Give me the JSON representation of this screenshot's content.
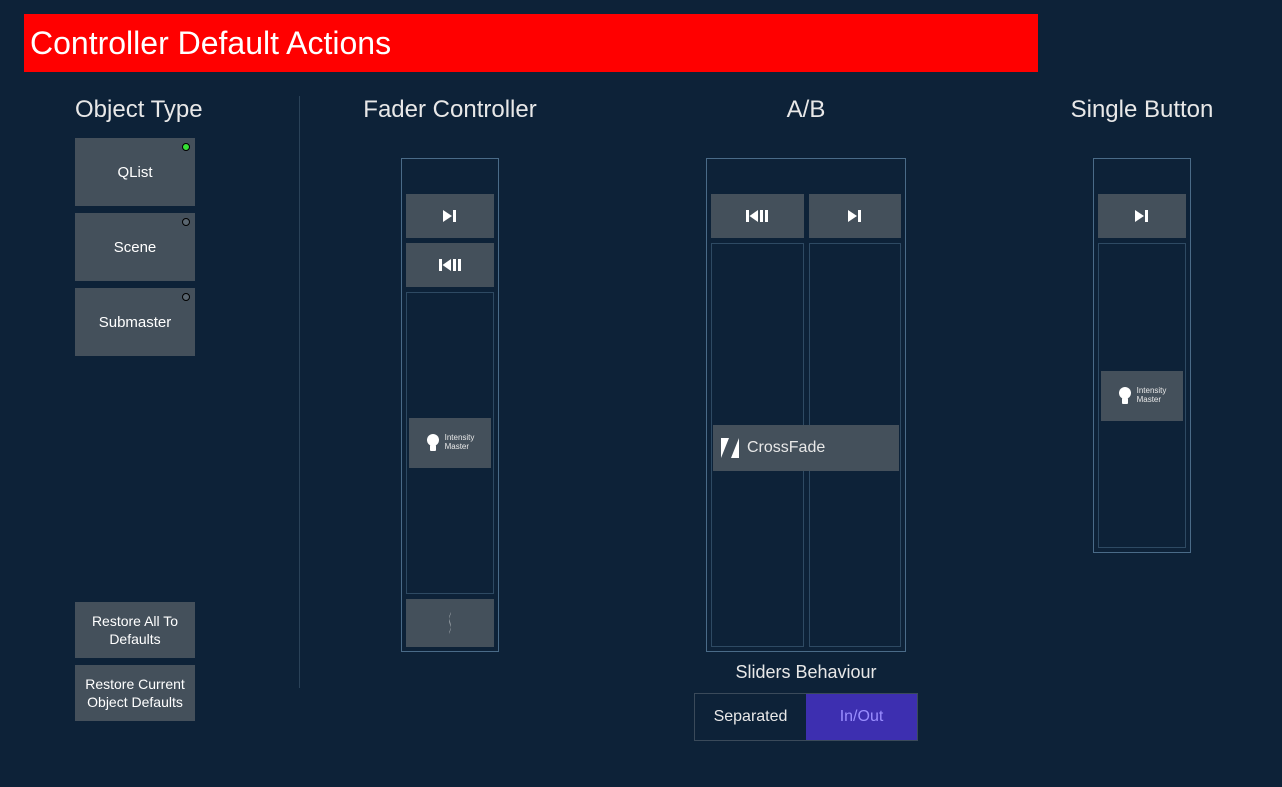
{
  "banner": {
    "title": "Controller Default Actions"
  },
  "sidebar": {
    "heading": "Object Type",
    "types": [
      {
        "label": "QList",
        "active": true
      },
      {
        "label": "Scene",
        "active": false
      },
      {
        "label": "Submaster",
        "active": false
      }
    ],
    "restore_all": "Restore All To Defaults",
    "restore_current": "Restore Current Object Defaults"
  },
  "columns": {
    "fader": {
      "heading": "Fader Controller",
      "intensity_line1": "Intensity",
      "intensity_line2": "Master"
    },
    "ab": {
      "heading": "A/B",
      "crossfade": "CrossFade",
      "sliders_heading": "Sliders Behaviour",
      "opt_separated": "Separated",
      "opt_inout": "In/Out",
      "selected": "In/Out"
    },
    "single": {
      "heading": "Single Button",
      "intensity_line1": "Intensity",
      "intensity_line2": "Master"
    }
  },
  "colors": {
    "background": "#0d2238",
    "banner": "#ff0000",
    "button": "#44505b",
    "accent": "#3d2fb0"
  }
}
